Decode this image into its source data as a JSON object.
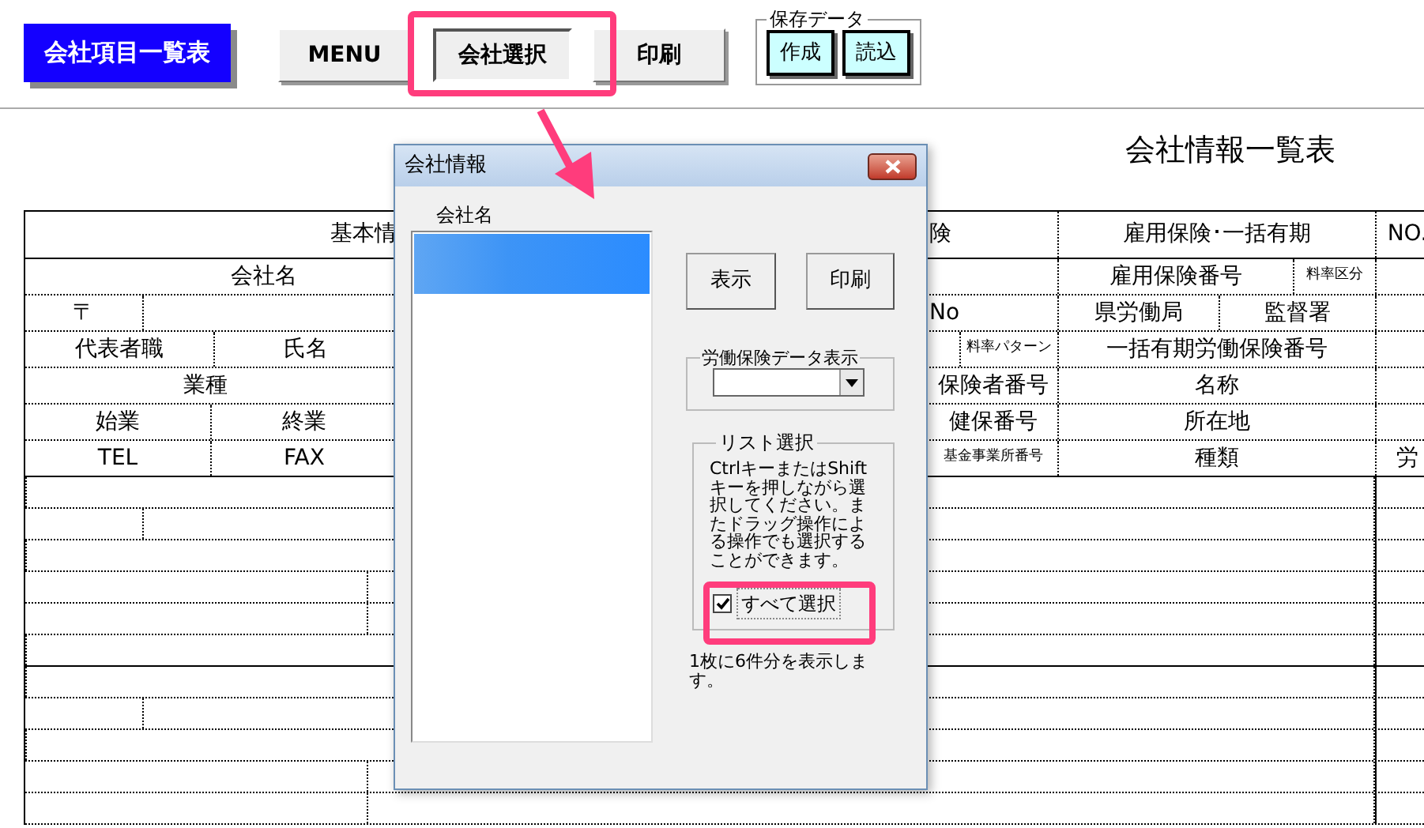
{
  "toolbar": {
    "buttons": [
      {
        "label": "会社項目一覧表",
        "kind": "primary",
        "pressed": false
      },
      {
        "label": "MENU",
        "kind": "normal",
        "pressed": false
      },
      {
        "label": "会社選択",
        "kind": "normal",
        "pressed": true
      },
      {
        "label": "印刷",
        "kind": "normal",
        "pressed": false
      }
    ],
    "save_group": {
      "label": "保存データ",
      "buttons": [
        "作成",
        "読込"
      ]
    }
  },
  "sheet": {
    "title": "会社情報一覧表",
    "rows": [
      {
        "left": [
          "基本情"
        ],
        "right": [
          "険",
          "雇用保険･一括有期",
          "NO."
        ]
      },
      {
        "left": [
          "会社名"
        ],
        "right": [
          "雇用保険番号",
          "料率区分"
        ]
      },
      {
        "left": [
          "〒"
        ],
        "right": [
          "No",
          "県労働局",
          "監督署"
        ]
      },
      {
        "left": [
          "代表者職",
          "氏名"
        ],
        "right": [
          "料率パターン",
          "一括有期労働保険番号"
        ]
      },
      {
        "left": [
          "業種"
        ],
        "right": [
          "保険者番号",
          "名称"
        ]
      },
      {
        "left": [
          "始業",
          "終業"
        ],
        "right": [
          "健保番号",
          "所在地"
        ]
      },
      {
        "left": [
          "TEL",
          "FAX"
        ],
        "right": [
          "基金事業所番号",
          "種類",
          "労"
        ]
      }
    ]
  },
  "dialog": {
    "title": "会社情報",
    "list": {
      "label": "会社名",
      "items": [
        {
          "selected": true
        }
      ]
    },
    "buttons": [
      "表示",
      "印刷"
    ],
    "insurance_group": {
      "label": "労働保険データ表示"
    },
    "select_group": {
      "label": "リスト選択",
      "help": "CtrlキーまたはShiftキーを押しながら選択してください。またドラッグ操作による操作でも選択することができます。",
      "checkbox": {
        "label": "すべて選択",
        "checked": true
      }
    },
    "note": "1枚に6件分を表示します。"
  }
}
